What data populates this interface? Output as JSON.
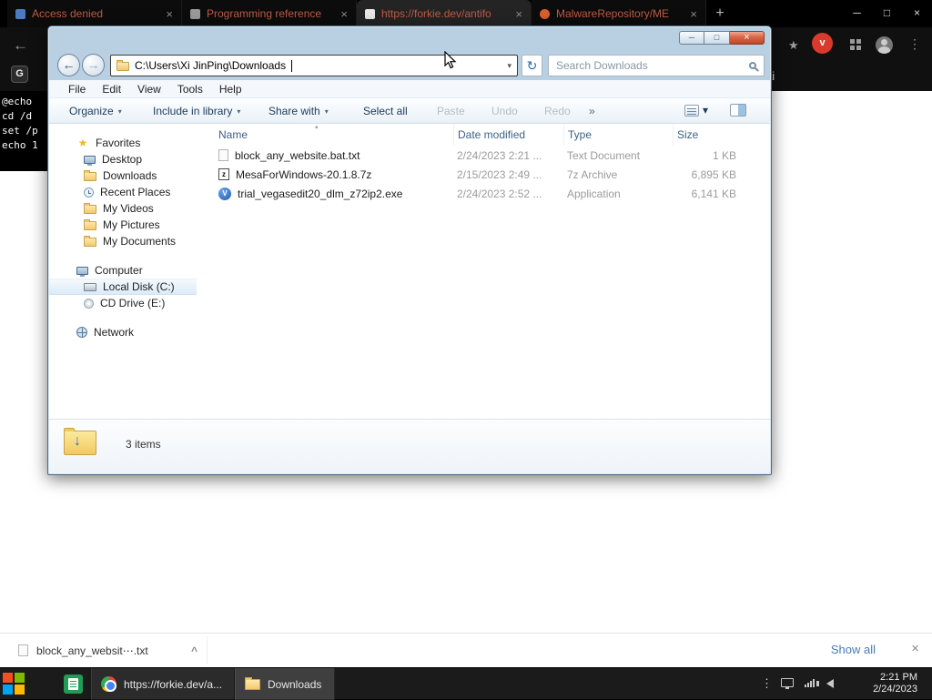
{
  "icons": {
    "close_x": "×",
    "new_tab": "+",
    "win_min": "─",
    "win_max": "□",
    "back": "←",
    "forward": "→",
    "dropdown": "▾",
    "refresh": "↻",
    "overflow": "»",
    "sort_asc": "▴",
    "chevron_up": "^",
    "menu_dots": "⋮",
    "download_check": "v",
    "arrow_down": "↓",
    "star": "★"
  },
  "browser": {
    "tabs": [
      {
        "label": "Access denied"
      },
      {
        "label": "Programming reference"
      },
      {
        "label": "https://forkie.dev/antifo"
      },
      {
        "label": "MalwareRepository/ME"
      }
    ],
    "page": {
      "badge": "G",
      "fragment": "ai"
    }
  },
  "terminal": {
    "lines": [
      "@echo",
      "cd /d",
      "set /p",
      "echo 1"
    ]
  },
  "explorer": {
    "address": "C:\\Users\\Xi JinPing\\Downloads",
    "search_placeholder": "Search Downloads",
    "menu": [
      "File",
      "Edit",
      "View",
      "Tools",
      "Help"
    ],
    "toolbar": [
      "Organize",
      "Include in library",
      "Share with",
      "Select all",
      "Paste",
      "Undo",
      "Redo"
    ],
    "sidebar": {
      "favorites_label": "Favorites",
      "favorites": [
        "Desktop",
        "Downloads",
        "Recent Places",
        "My Videos",
        "My Pictures",
        "My Documents"
      ],
      "computer_label": "Computer",
      "computer": [
        "Local Disk (C:)",
        "CD Drive (E:)"
      ],
      "network_label": "Network"
    },
    "columns": [
      "Name",
      "Date modified",
      "Type",
      "Size"
    ],
    "files": [
      {
        "name": "block_any_website.bat.txt",
        "date_modified": "2/24/2023 2:21 ...",
        "type": "Text Document",
        "size": "1 KB",
        "icon_label": ""
      },
      {
        "name": "MesaForWindows-20.1.8.7z",
        "date_modified": "2/15/2023 2:49 ...",
        "type": "7z Archive",
        "size": "6,895 KB",
        "icon_label": "z"
      },
      {
        "name": "trial_vegasedit20_dlm_z72ip2.exe",
        "date_modified": "2/24/2023 2:52 ...",
        "type": "Application",
        "size": "6,141 KB",
        "icon_label": "V"
      }
    ],
    "status": "3 items"
  },
  "download_bar": {
    "filename": "block_any_websit⋯.txt",
    "show_all": "Show all"
  },
  "taskbar": {
    "chrome_button": "https://forkie.dev/a...",
    "downloads_button": "Downloads",
    "clock": {
      "time": "2:21 PM",
      "date": "2/24/2023"
    }
  }
}
